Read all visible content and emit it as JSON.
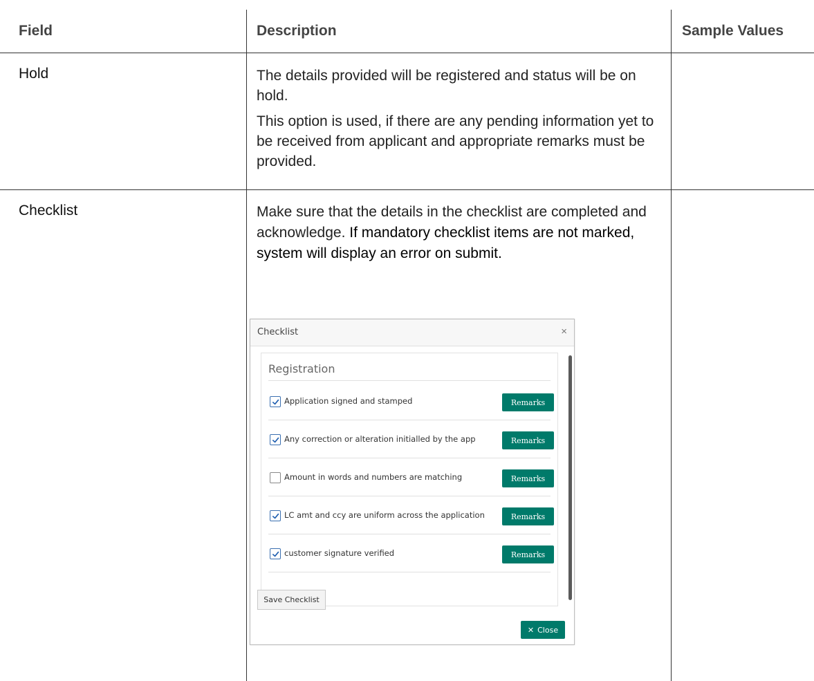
{
  "table": {
    "headers": [
      "Field",
      "Description",
      "Sample Values"
    ],
    "rows": [
      {
        "field": "Hold",
        "description": [
          "The details provided will be registered and status will be on hold.",
          "This option is used, if there are any pending information yet to be received from applicant and appropriate remarks must be provided."
        ],
        "sample": ""
      },
      {
        "field": "Checklist",
        "description_part1": "Make sure that the details in the checklist are completed and acknowledge.",
        "description_part2": " If mandatory checklist items are not marked, system will display an error on submit.",
        "sample": ""
      }
    ]
  },
  "dialog": {
    "title": "Checklist",
    "close_icon": "close-icon",
    "section": "Registration",
    "items": [
      {
        "label": "Application signed and stamped",
        "checked": true,
        "remarks_label": "Remarks"
      },
      {
        "label": "Any correction or alteration initialled by the  app",
        "checked": true,
        "remarks_label": "Remarks"
      },
      {
        "label": "Amount in words and numbers are matching",
        "checked": false,
        "remarks_label": "Remarks"
      },
      {
        "label": "LC amt and ccy are uniform across the application",
        "checked": true,
        "remarks_label": "Remarks"
      },
      {
        "label": "customer signature verified",
        "checked": true,
        "remarks_label": "Remarks"
      }
    ],
    "save_label": "Save Checklist",
    "close_label": "Close",
    "accent": "#007a6a"
  }
}
